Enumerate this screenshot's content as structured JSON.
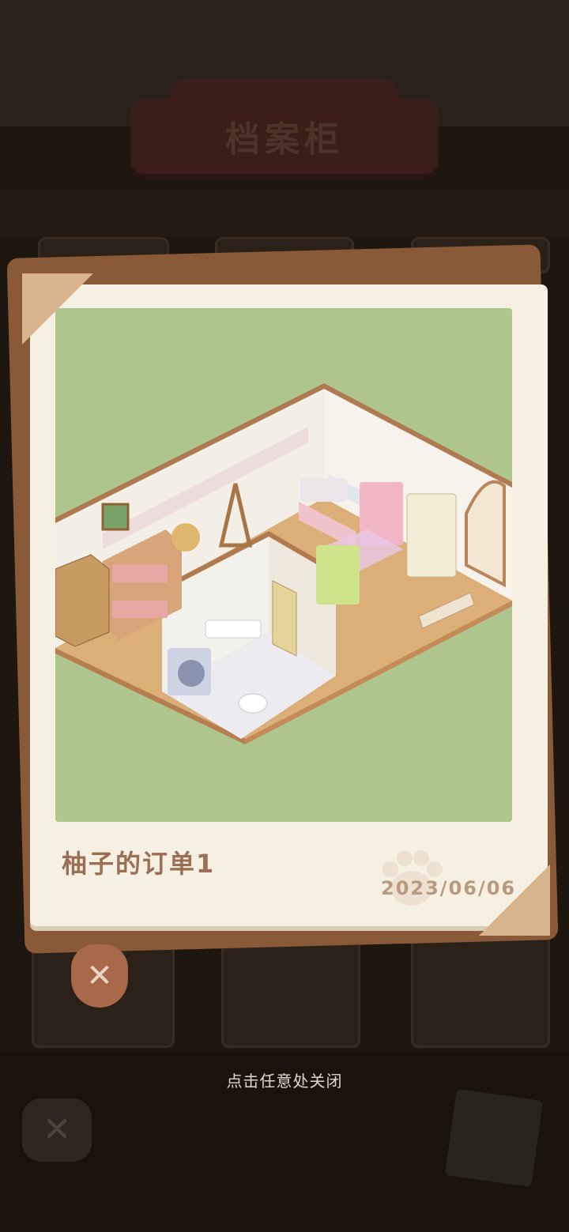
{
  "background": {
    "title": "档案柜"
  },
  "photo_card": {
    "title": "柚子的订单1",
    "date": "2023/06/06"
  },
  "hint": "点击任意处关闭",
  "icons": {
    "close": "close-icon",
    "paw": "paw-icon"
  }
}
